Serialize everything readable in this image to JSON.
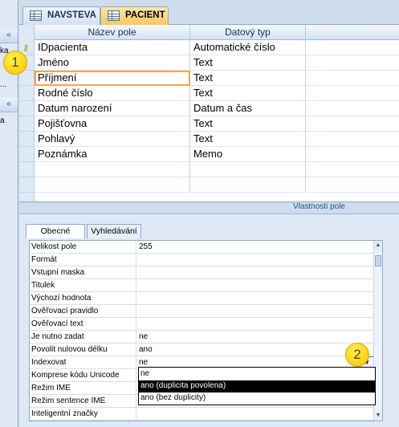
{
  "tabs": [
    {
      "label": "NAVSTEVA",
      "active": false
    },
    {
      "label": "PACIENT",
      "active": true
    }
  ],
  "nav": {
    "collapse1": "«",
    "collapse2": "«",
    "frag1": "ka",
    "frag2": "...",
    "frag3": "a"
  },
  "grid": {
    "col_name": "Název pole",
    "col_type": "Datový typ",
    "rows": [
      {
        "name": "IDpacienta",
        "type": "Automatické číslo",
        "primary_key": true
      },
      {
        "name": "Jméno",
        "type": "Text"
      },
      {
        "name": "Příjmení",
        "type": "Text"
      },
      {
        "name": "Rodné číslo",
        "type": "Text"
      },
      {
        "name": "Datum narození",
        "type": "Datum a čas"
      },
      {
        "name": "Pojišťovna",
        "type": "Text"
      },
      {
        "name": "Pohlavý",
        "type": "Text"
      },
      {
        "name": "Poznámka",
        "type": "Memo"
      }
    ]
  },
  "properties": {
    "header": "Vlastnosti pole",
    "tab_general": "Obecné",
    "tab_lookup": "Vyhledávání",
    "rows": [
      {
        "label": "Velikost pole",
        "value": "255"
      },
      {
        "label": "Formát",
        "value": ""
      },
      {
        "label": "Vstupní maska",
        "value": ""
      },
      {
        "label": "Titulek",
        "value": ""
      },
      {
        "label": "Výchozí hodnota",
        "value": ""
      },
      {
        "label": "Ověřovací pravidlo",
        "value": ""
      },
      {
        "label": "Ověřovací text",
        "value": ""
      },
      {
        "label": "Je nutno zadat",
        "value": "ne"
      },
      {
        "label": "Povolit nulovou délku",
        "value": "ano"
      },
      {
        "label": "Indexovat",
        "value": "ne"
      },
      {
        "label": "Komprese kódu Unicode",
        "value": ""
      },
      {
        "label": "Režim IME",
        "value": ""
      },
      {
        "label": "Režim sentence IME",
        "value": ""
      },
      {
        "label": "Inteligentní značky",
        "value": ""
      }
    ],
    "dropdown_options": [
      "ne",
      "ano (duplicita povolena)",
      "ano (bez duplicity)"
    ],
    "highlighted_option": "ano (duplicita povolena)"
  },
  "badges": [
    "1",
    "2"
  ],
  "icons": {
    "key": "key-icon",
    "table": "table-icon",
    "dropdown": "dropdown-arrow-icon"
  }
}
